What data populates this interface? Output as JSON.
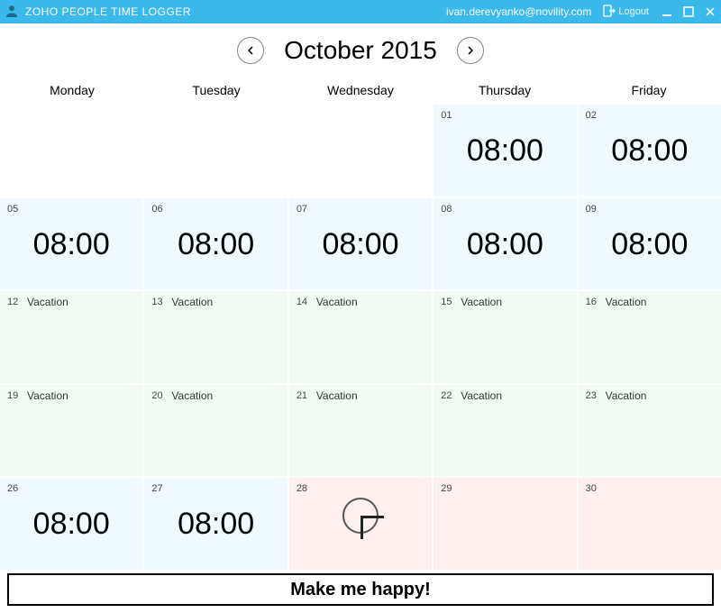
{
  "titlebar": {
    "app_name": "ZOHO PEOPLE TIME LOGGER",
    "user_email": "ivan.derevyanko@novility.com",
    "logout_label": "Logout"
  },
  "nav": {
    "month_label": "October 2015"
  },
  "day_headers": [
    "Monday",
    "Tuesday",
    "Wednesday",
    "Thursday",
    "Friday"
  ],
  "weeks": [
    [
      {
        "type": "blank"
      },
      {
        "type": "blank"
      },
      {
        "type": "blank"
      },
      {
        "date": "01",
        "type": "time",
        "time": "08:00"
      },
      {
        "date": "02",
        "type": "time",
        "time": "08:00"
      }
    ],
    [
      {
        "date": "05",
        "type": "time",
        "time": "08:00"
      },
      {
        "date": "06",
        "type": "time",
        "time": "08:00"
      },
      {
        "date": "07",
        "type": "time",
        "time": "08:00"
      },
      {
        "date": "08",
        "type": "time",
        "time": "08:00"
      },
      {
        "date": "09",
        "type": "time",
        "time": "08:00"
      }
    ],
    [
      {
        "date": "12",
        "type": "vac",
        "label": "Vacation"
      },
      {
        "date": "13",
        "type": "vac",
        "label": "Vacation"
      },
      {
        "date": "14",
        "type": "vac",
        "label": "Vacation"
      },
      {
        "date": "15",
        "type": "vac",
        "label": "Vacation"
      },
      {
        "date": "16",
        "type": "vac",
        "label": "Vacation"
      }
    ],
    [
      {
        "date": "19",
        "type": "vac",
        "label": "Vacation"
      },
      {
        "date": "20",
        "type": "vac",
        "label": "Vacation"
      },
      {
        "date": "21",
        "type": "vac",
        "label": "Vacation"
      },
      {
        "date": "22",
        "type": "vac",
        "label": "Vacation"
      },
      {
        "date": "23",
        "type": "vac",
        "label": "Vacation"
      }
    ],
    [
      {
        "date": "26",
        "type": "time",
        "time": "08:00"
      },
      {
        "date": "27",
        "type": "time",
        "time": "08:00"
      },
      {
        "date": "28",
        "type": "today"
      },
      {
        "date": "29",
        "type": "future"
      },
      {
        "date": "30",
        "type": "future"
      }
    ]
  ],
  "footer": {
    "label": "Make me happy!"
  }
}
